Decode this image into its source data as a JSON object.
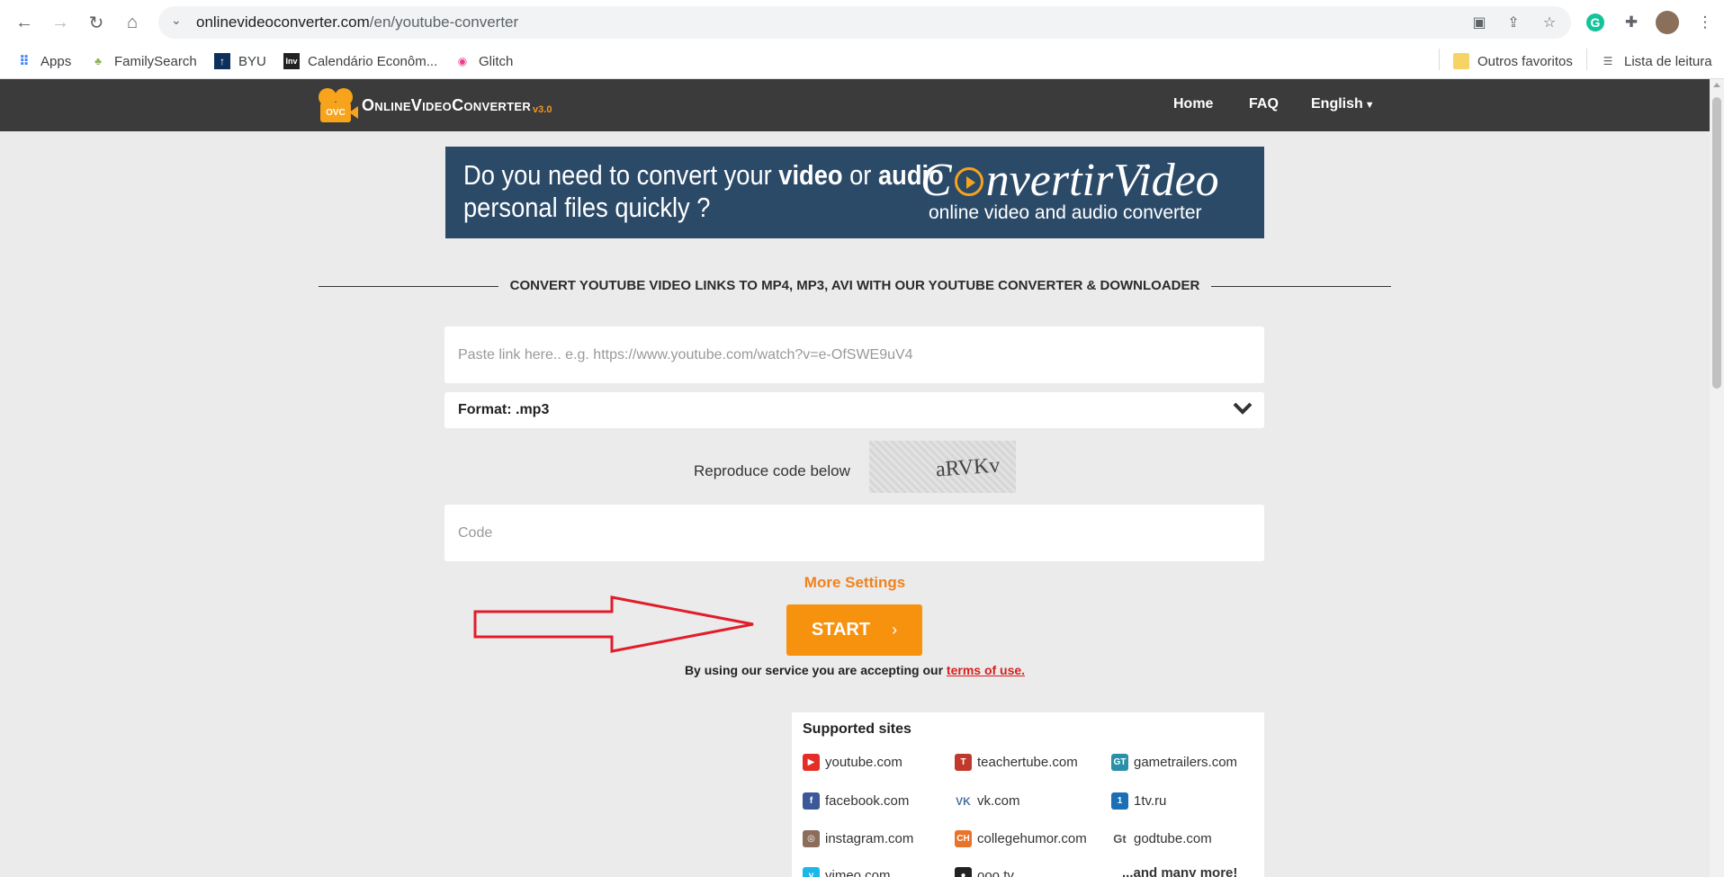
{
  "browser": {
    "url_domain": "onlinevideoconverter.com",
    "url_path": "/en/youtube-converter",
    "bookmarks": [
      {
        "label": "Apps",
        "icon": "apps-grid-icon"
      },
      {
        "label": "FamilySearch",
        "icon": "familysearch-icon"
      },
      {
        "label": "BYU",
        "icon": "byu-icon"
      },
      {
        "label": "Calendário Econôm...",
        "icon": "investing-icon"
      },
      {
        "label": "Glitch",
        "icon": "glitch-icon"
      }
    ],
    "other_bookmarks": "Outros favoritos",
    "reading_list": "Lista de leitura"
  },
  "site": {
    "logo_text": "OnlineVideoConverter",
    "logo_badge": "OVC",
    "logo_version": "v3.0",
    "nav": [
      "Home",
      "FAQ",
      "English"
    ],
    "accent_color": "#f7920f",
    "header_color": "#3b3b3b"
  },
  "banner": {
    "line1_prefix": "Do you need to convert your ",
    "line1_video": "video",
    "line1_or": " or ",
    "line1_audio": "audio",
    "line2": "personal files quickly ?",
    "brand_c": "C",
    "brand_rest": "nvertirVideo",
    "subtitle": "online video and audio converter"
  },
  "main": {
    "heading": "CONVERT YOUTUBE VIDEO LINKS TO MP4, MP3, AVI WITH OUR YOUTUBE CONVERTER & DOWNLOADER",
    "link_placeholder": "Paste link here.. e.g. https://www.youtube.com/watch?v=e-OfSWE9uV4",
    "format_label": "Format: .mp3",
    "captcha_label": "Reproduce code below",
    "captcha_code": "aRVKv",
    "code_placeholder": "Code",
    "more_settings": "More Settings",
    "start_label": "START",
    "start_chevron": "›",
    "terms_prefix": "By using our service you are accepting our ",
    "terms_link": "terms of use."
  },
  "supported": {
    "title": "Supported sites",
    "sites": [
      {
        "label": "youtube.com",
        "icon": "youtube-icon",
        "color": "#e52d27"
      },
      {
        "label": "teachertube.com",
        "icon": "teachertube-icon",
        "color": "#c0392b"
      },
      {
        "label": "gametrailers.com",
        "icon": "gametrailers-icon",
        "color": "#2a8fa8"
      },
      {
        "label": "facebook.com",
        "icon": "facebook-icon",
        "color": "#3b5998"
      },
      {
        "label": "vk.com",
        "icon": "vk-icon",
        "color": "#4c75a3"
      },
      {
        "label": "1tv.ru",
        "icon": "1tv-icon",
        "color": "#1a6fb5"
      },
      {
        "label": "instagram.com",
        "icon": "instagram-icon",
        "color": "#8a6d5a"
      },
      {
        "label": "collegehumor.com",
        "icon": "collegehumor-icon",
        "color": "#e8732b"
      },
      {
        "label": "godtube.com",
        "icon": "godtube-icon",
        "color": "#555555"
      },
      {
        "label": "vimeo.com",
        "icon": "vimeo-icon",
        "color": "#1ab7ea"
      },
      {
        "label": "ooo.tv",
        "icon": "ooo-icon",
        "color": "#222222"
      },
      {
        "label": "...and many more!",
        "icon": "",
        "color": ""
      }
    ]
  }
}
